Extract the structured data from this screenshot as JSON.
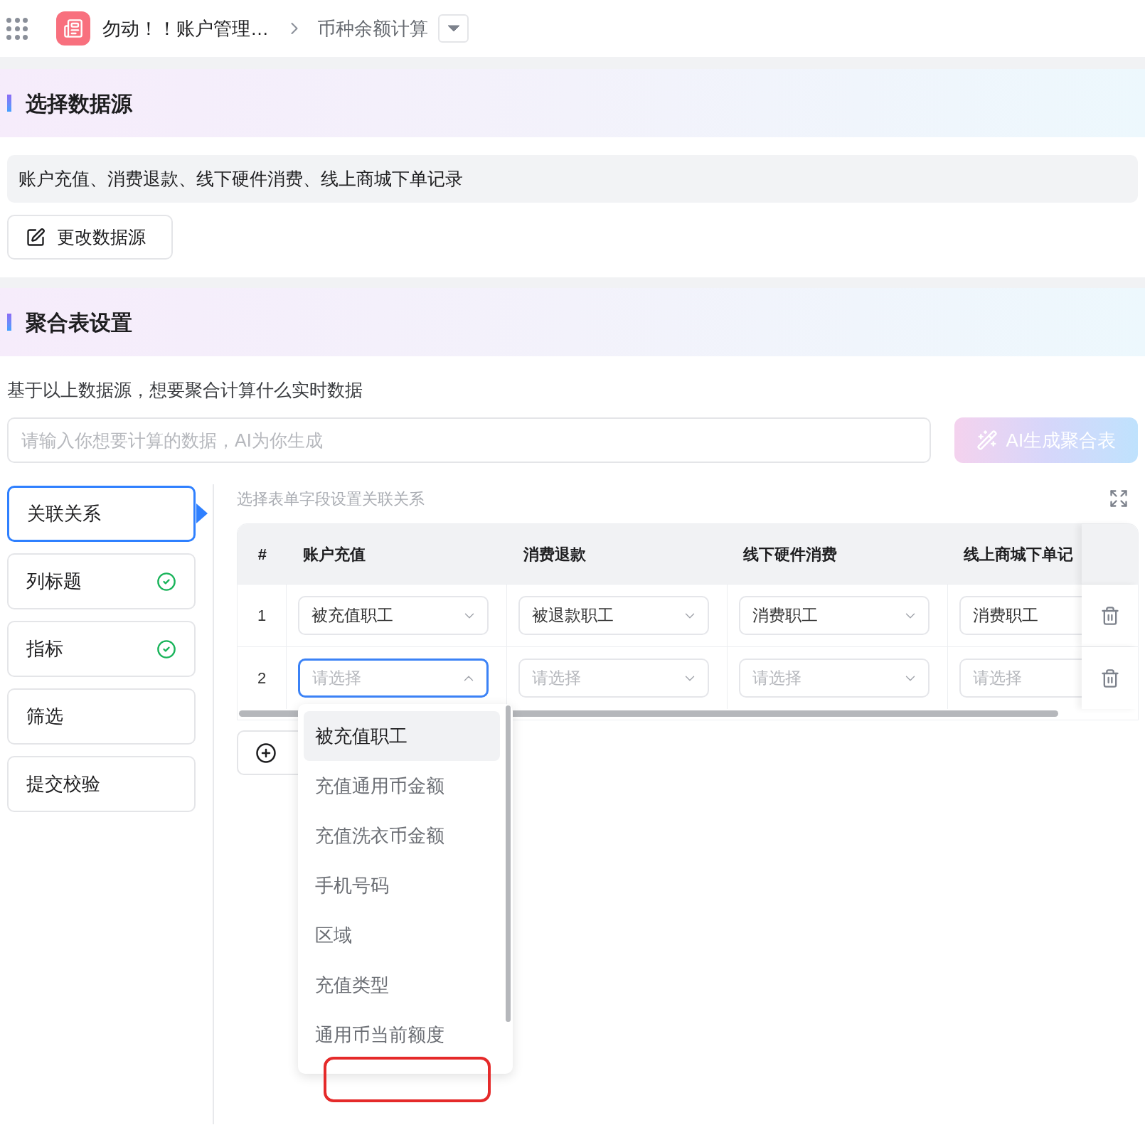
{
  "breadcrumb": {
    "app_title": "勿动！！账户管理…",
    "page": "币种余额计算"
  },
  "data_source_section": {
    "title": "选择数据源",
    "sources_text": "账户充值、消费退款、线下硬件消费、线上商城下单记录",
    "change_button": "更改数据源"
  },
  "aggregate_section": {
    "title": "聚合表设置",
    "prompt_label": "基于以上数据源，想要聚合计算什么实时数据",
    "prompt_input": {
      "placeholder": "请输入你想要计算的数据，AI为你生成"
    },
    "ai_button": "AI生成聚合表"
  },
  "steps": [
    {
      "label": "关联关系",
      "selected": true,
      "completed": false
    },
    {
      "label": "列标题",
      "selected": false,
      "completed": true
    },
    {
      "label": "指标",
      "selected": false,
      "completed": true
    },
    {
      "label": "筛选",
      "selected": false,
      "completed": false
    },
    {
      "label": "提交校验",
      "selected": false,
      "completed": false
    }
  ],
  "relation": {
    "hint": "选择表单字段设置关联关系",
    "columns": [
      "#",
      "账户充值",
      "消费退款",
      "线下硬件消费",
      "线上商城下单记"
    ],
    "rows": [
      {
        "cells": [
          {
            "kind": "index",
            "text": "1"
          },
          {
            "kind": "select",
            "value": "被充值职工",
            "open": false
          },
          {
            "kind": "select",
            "value": "被退款职工",
            "open": false
          },
          {
            "kind": "select",
            "value": "消费职工",
            "open": false
          },
          {
            "kind": "select",
            "value": "消费职工",
            "open": false
          }
        ]
      },
      {
        "cells": [
          {
            "kind": "index",
            "text": "2"
          },
          {
            "kind": "select",
            "placeholder": "请选择",
            "open": true
          },
          {
            "kind": "select",
            "placeholder": "请选择",
            "open": false
          },
          {
            "kind": "select",
            "placeholder": "请选择",
            "open": false
          },
          {
            "kind": "select",
            "placeholder": "请选择",
            "open": false
          }
        ]
      }
    ]
  },
  "dropdown": {
    "options": [
      {
        "label": "被充值职工",
        "selected": true
      },
      {
        "label": "充值通用币金额",
        "selected": false
      },
      {
        "label": "充值洗衣币金额",
        "selected": false
      },
      {
        "label": "手机号码",
        "selected": false
      },
      {
        "label": "区域",
        "selected": false
      },
      {
        "label": "充值类型",
        "selected": false
      },
      {
        "label": "通用币当前额度",
        "selected": false
      }
    ]
  }
}
